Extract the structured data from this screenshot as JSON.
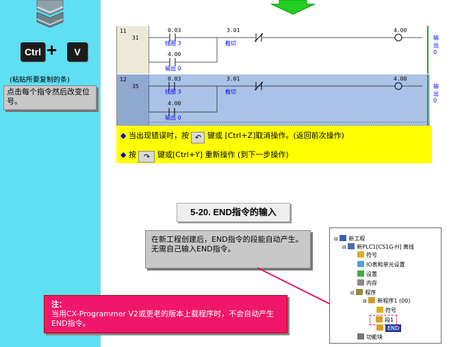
{
  "sidebar": {
    "key_ctrl": "Ctrl",
    "key_plus": "+",
    "key_v": "V",
    "caption": "(粘贴所要复制的条)",
    "tip": "点击每个指令然后改变位号。"
  },
  "ladder": {
    "rungs": [
      {
        "num": "11",
        "step": "31",
        "contact1_addr": "0.03",
        "contact1_comment": "线圈 3",
        "contact2_addr": "3.01",
        "contact2_comment": "截切",
        "coil_addr": "4.00",
        "coil_comment": "输出 0",
        "branch_addr": "4.00",
        "branch_comment": "输出 0"
      },
      {
        "num": "12",
        "step": "35",
        "contact1_addr": "0.03",
        "contact1_comment": "线圈 3",
        "contact2_addr": "3.01",
        "contact2_comment": "截切",
        "coil_addr": "4.00",
        "coil_comment": "输出 0",
        "branch_addr": "4.00",
        "branch_comment": "输出 0"
      }
    ]
  },
  "notes": {
    "undo_pre": "当出现错误时，按",
    "undo_post": "键或 [Ctrl+Z]取消操作。(返回前次操作)",
    "redo_pre": "按",
    "redo_post": "键或[Ctrl+Y] 重新操作 (到下一步操作)"
  },
  "section_title": "5-20. END指令的输入",
  "end_info": {
    "line1": "在新工程创建后，END指令的段能自动产生。",
    "line2": "无需自己输入END指令。"
  },
  "note_box": {
    "heading": "注：",
    "text": "当用CX-Programmer V2或更老的版本上载程序时，不会自动产生END指令。"
  },
  "tree": {
    "root": "新工程",
    "plc": "新PLC1[CS1G-H] 离线",
    "symbols": "符号",
    "io_table": "IO表和单元设置",
    "settings": "设置",
    "memory": "内存",
    "programs": "程序",
    "program1": "新程序1 (00)",
    "prog_symbols": "符号",
    "section1": "段1",
    "end": "END",
    "function_blocks": "功能块"
  },
  "colors": {
    "sidebar": "#5fdff2",
    "selected_rung": "#a9c2e6",
    "note_yellow": "#ffff00",
    "pink": "#f0176a",
    "arrow_green": "#22cc22"
  }
}
